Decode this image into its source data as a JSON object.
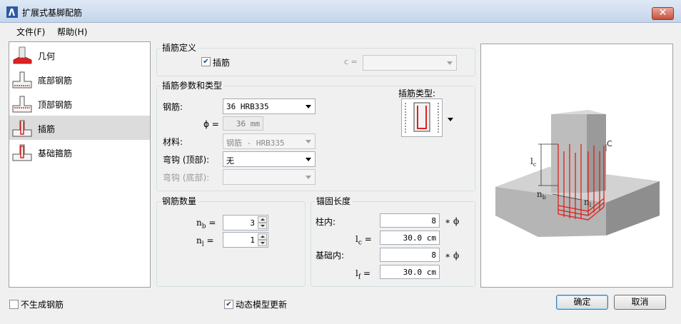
{
  "window": {
    "title": "扩展式基脚配筋",
    "close_label": "✕"
  },
  "menu": {
    "items": [
      "文件(F)",
      "帮助(H)"
    ]
  },
  "nav": {
    "items": [
      {
        "label": "几何",
        "icon": "geometry-icon"
      },
      {
        "label": "底部钢筋",
        "icon": "bottom-rebar-icon"
      },
      {
        "label": "顶部钢筋",
        "icon": "top-rebar-icon"
      },
      {
        "label": "插筋",
        "icon": "dowel-icon",
        "selected": true
      },
      {
        "label": "基础箍筋",
        "icon": "stirrup-icon"
      }
    ]
  },
  "dowel_def": {
    "group_title": "插筋定义",
    "checkbox_label": "插筋",
    "checked": true,
    "c_label": "c =",
    "c_value": ""
  },
  "dowel_params": {
    "group_title": "插筋参数和类型",
    "rebar_label": "钢筋:",
    "rebar_value": "36 HRB335",
    "phi_label": "ϕ =",
    "phi_value": "36 mm",
    "material_label": "材料:",
    "material_value": "钢筋 - HRB335",
    "hook_top_label": "弯钩 (顶部):",
    "hook_top_value": "无",
    "hook_bottom_label": "弯钩 (底部):",
    "hook_bottom_value": "",
    "type_label": "插筋类型:"
  },
  "rebar_count": {
    "group_title": "钢筋数量",
    "nb_label": "n",
    "nb_sub": "b",
    "nb_value": "3",
    "nl_label": "n",
    "nl_sub": "l",
    "nl_value": "1",
    "eq": "="
  },
  "anchorage": {
    "group_title": "锚固长度",
    "column_label": "柱内:",
    "column_value": "8",
    "lc_label": "l",
    "lc_sub": "c",
    "lc_value": "30.0 cm",
    "foundation_label": "基础内:",
    "foundation_value": "8",
    "lf_label": "l",
    "lf_sub": "f",
    "lf_value": "30.0 cm",
    "times_phi": "∗ ϕ",
    "eq": "="
  },
  "footer": {
    "no_rebar_label": "不生成钢筋",
    "no_rebar_checked": false,
    "dynamic_update_label": "动态模型更新",
    "dynamic_update_checked": true,
    "ok_label": "确定",
    "cancel_label": "取消"
  },
  "preview": {
    "label_lc": "l",
    "label_lc_sub": "c",
    "label_nb": "n",
    "label_nb_sub": "b",
    "label_nl": "n",
    "label_nl_sub": "l",
    "label_c": "C"
  },
  "colors": {
    "rebar_red": "#e0201a",
    "concrete": "#b8b8b8",
    "accent": "#3c7fb1"
  }
}
